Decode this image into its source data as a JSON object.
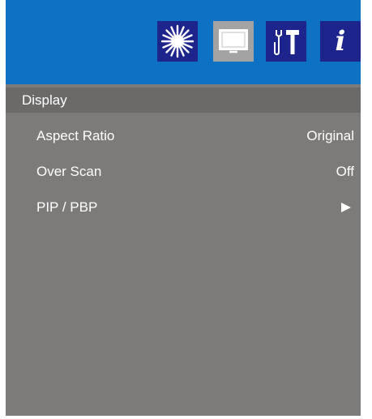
{
  "tabs": [
    {
      "icon": "brightness-icon",
      "active": false
    },
    {
      "icon": "display-icon",
      "active": true
    },
    {
      "icon": "tools-icon",
      "active": false
    },
    {
      "icon": "info-icon",
      "active": false,
      "glyph": "i"
    }
  ],
  "section": {
    "title": "Display"
  },
  "menu": {
    "items": [
      {
        "label": "Aspect Ratio",
        "value": "Original"
      },
      {
        "label": "Over Scan",
        "value": "Off"
      },
      {
        "label": "PIP / PBP",
        "value": ""
      }
    ],
    "submenu_icon": "right-arrow-icon"
  },
  "colors": {
    "header": "#0e72c4",
    "tab": "#1d248c",
    "tab_active": "#a3a3a3",
    "panel": "#7d7b79",
    "section_bar": "#6c6a69"
  }
}
